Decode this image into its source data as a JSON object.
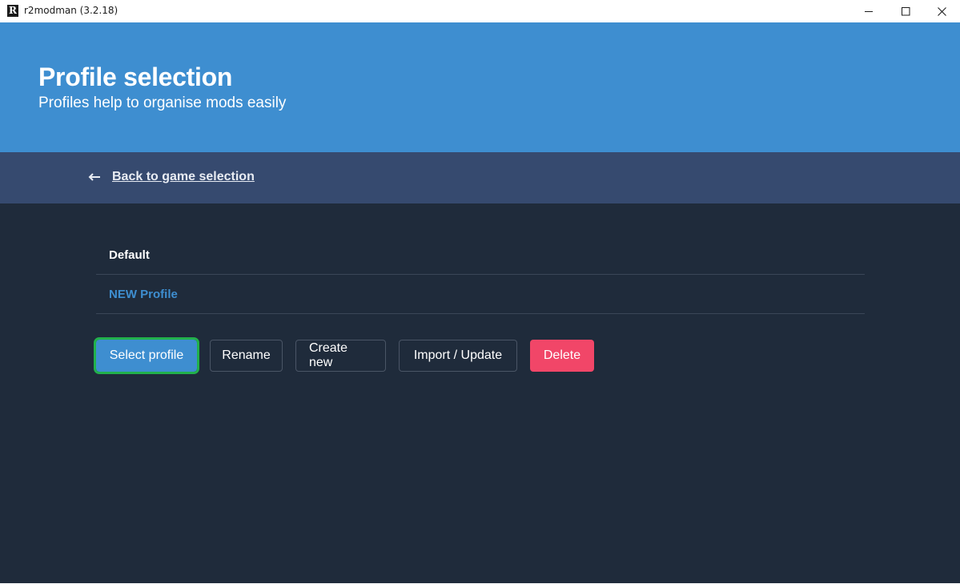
{
  "window": {
    "icon_letter": "R",
    "title": "r2modman (3.2.18)"
  },
  "hero": {
    "title": "Profile selection",
    "subtitle": "Profiles help to organise mods easily"
  },
  "nav": {
    "back_label": "Back to game selection"
  },
  "profiles": [
    {
      "name": "Default",
      "selected": false
    },
    {
      "name": "NEW Profile",
      "selected": true
    }
  ],
  "actions": {
    "select_label": "Select profile",
    "rename_label": "Rename",
    "create_label": "Create new",
    "import_label": "Import / Update",
    "delete_label": "Delete"
  },
  "colors": {
    "primary": "#3e8ed0",
    "navbar": "#364a6f",
    "background": "#1f2b3b",
    "danger": "#f14668",
    "focus_outline": "#22b14c"
  }
}
